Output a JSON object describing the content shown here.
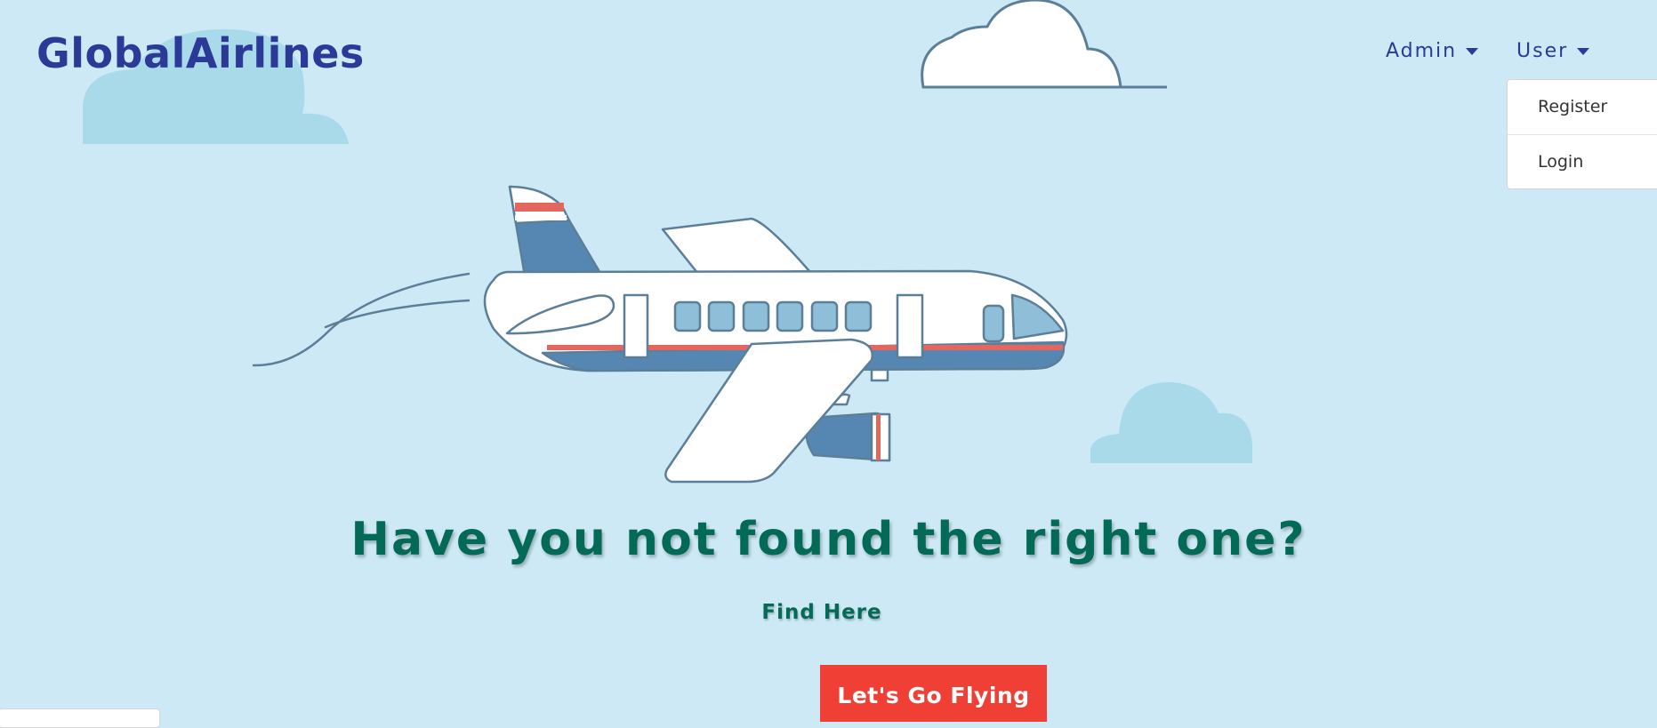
{
  "navbar": {
    "brand": "GlobalAirlines",
    "admin_label": "Admin",
    "user_label": "User",
    "user_menu": {
      "items": [
        {
          "label": "Register"
        },
        {
          "label": "Login"
        }
      ]
    }
  },
  "hero": {
    "headline": "Have you not found the right one?",
    "find_link": "Find Here",
    "cta_label": "Let's Go Flying"
  },
  "colors": {
    "background": "#cde9f6",
    "brand": "#2b3a97",
    "headline": "#046a58",
    "cta": "#f04035",
    "plane_blue": "#5687b3",
    "window": "#8fbfd8",
    "stripe": "#e3675f"
  },
  "icons": [
    "airplane-illustration",
    "cloud-icon",
    "caret-down-icon"
  ]
}
